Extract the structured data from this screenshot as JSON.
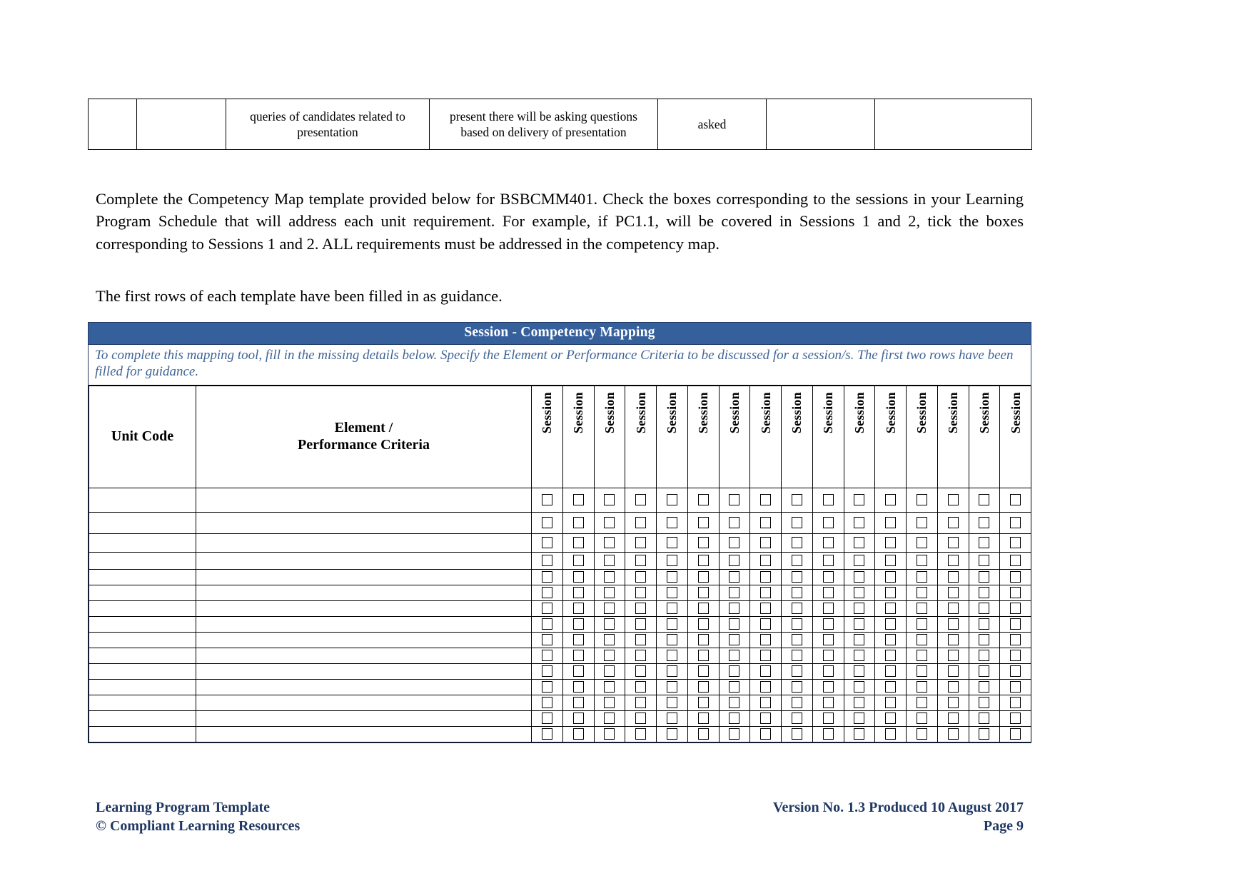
{
  "top_table": {
    "columns": 7,
    "rows": [
      {
        "cells": [
          "",
          "",
          "queries of candidates related to presentation",
          "present there will be asking questions based on delivery of presentation",
          "asked",
          "",
          ""
        ]
      }
    ]
  },
  "body": {
    "paragraph_main": "Complete the Competency Map template provided below for BSBCMM401. Check the boxes corresponding to the sessions in your Learning Program Schedule that will address each unit requirement. For example, if PC1.1, will be covered in Sessions 1 and 2, tick the boxes corresponding to Sessions 1 and 2. ALL requirements must be addressed in the competency map.",
    "paragraph_guidance": "The first rows of each template have been filled in as guidance."
  },
  "map": {
    "title": "Session - Competency Mapping",
    "note": "To complete this mapping tool, fill in the missing details below. Specify the Element or Performance Criteria to be discussed for a session/s. The first two rows have been filled for guidance.",
    "headers": {
      "unit_code": "Unit Code",
      "element_line1": "Element /",
      "element_line2": "Performance Criteria",
      "session": "Session"
    },
    "session_column_count": 16,
    "data_rows": 15,
    "rows": [
      {
        "unit_code": "",
        "element": "",
        "sessions": [
          false,
          false,
          false,
          false,
          false,
          false,
          false,
          false,
          false,
          false,
          false,
          false,
          false,
          false,
          false,
          false
        ]
      },
      {
        "unit_code": "",
        "element": "",
        "sessions": [
          false,
          false,
          false,
          false,
          false,
          false,
          false,
          false,
          false,
          false,
          false,
          false,
          false,
          false,
          false,
          false
        ]
      },
      {
        "unit_code": "",
        "element": "",
        "sessions": [
          false,
          false,
          false,
          false,
          false,
          false,
          false,
          false,
          false,
          false,
          false,
          false,
          false,
          false,
          false,
          false
        ]
      },
      {
        "unit_code": "",
        "element": "",
        "sessions": [
          false,
          false,
          false,
          false,
          false,
          false,
          false,
          false,
          false,
          false,
          false,
          false,
          false,
          false,
          false,
          false
        ]
      },
      {
        "unit_code": "",
        "element": "",
        "sessions": [
          false,
          false,
          false,
          false,
          false,
          false,
          false,
          false,
          false,
          false,
          false,
          false,
          false,
          false,
          false,
          false
        ]
      },
      {
        "unit_code": "",
        "element": "",
        "sessions": [
          false,
          false,
          false,
          false,
          false,
          false,
          false,
          false,
          false,
          false,
          false,
          false,
          false,
          false,
          false,
          false
        ]
      },
      {
        "unit_code": "",
        "element": "",
        "sessions": [
          false,
          false,
          false,
          false,
          false,
          false,
          false,
          false,
          false,
          false,
          false,
          false,
          false,
          false,
          false,
          false
        ]
      },
      {
        "unit_code": "",
        "element": "",
        "sessions": [
          false,
          false,
          false,
          false,
          false,
          false,
          false,
          false,
          false,
          false,
          false,
          false,
          false,
          false,
          false,
          false
        ]
      },
      {
        "unit_code": "",
        "element": "",
        "sessions": [
          false,
          false,
          false,
          false,
          false,
          false,
          false,
          false,
          false,
          false,
          false,
          false,
          false,
          false,
          false,
          false
        ]
      },
      {
        "unit_code": "",
        "element": "",
        "sessions": [
          false,
          false,
          false,
          false,
          false,
          false,
          false,
          false,
          false,
          false,
          false,
          false,
          false,
          false,
          false,
          false
        ]
      },
      {
        "unit_code": "",
        "element": "",
        "sessions": [
          false,
          false,
          false,
          false,
          false,
          false,
          false,
          false,
          false,
          false,
          false,
          false,
          false,
          false,
          false,
          false
        ]
      },
      {
        "unit_code": "",
        "element": "",
        "sessions": [
          false,
          false,
          false,
          false,
          false,
          false,
          false,
          false,
          false,
          false,
          false,
          false,
          false,
          false,
          false,
          false
        ]
      },
      {
        "unit_code": "",
        "element": "",
        "sessions": [
          false,
          false,
          false,
          false,
          false,
          false,
          false,
          false,
          false,
          false,
          false,
          false,
          false,
          false,
          false,
          false
        ]
      },
      {
        "unit_code": "",
        "element": "",
        "sessions": [
          false,
          false,
          false,
          false,
          false,
          false,
          false,
          false,
          false,
          false,
          false,
          false,
          false,
          false,
          false,
          false
        ]
      },
      {
        "unit_code": "",
        "element": "",
        "sessions": [
          false,
          false,
          false,
          false,
          false,
          false,
          false,
          false,
          false,
          false,
          false,
          false,
          false,
          false,
          false,
          false
        ]
      }
    ]
  },
  "footer": {
    "left_line1": "Learning Program Template",
    "left_line2": "© Compliant Learning Resources",
    "right_line1": "Version No. 1.3 Produced 10 August 2017",
    "right_line2": "Page 9"
  },
  "colors": {
    "header_blue": "#36609c",
    "note_blue": "#3f6496",
    "footer_navy": "#1f3864"
  }
}
